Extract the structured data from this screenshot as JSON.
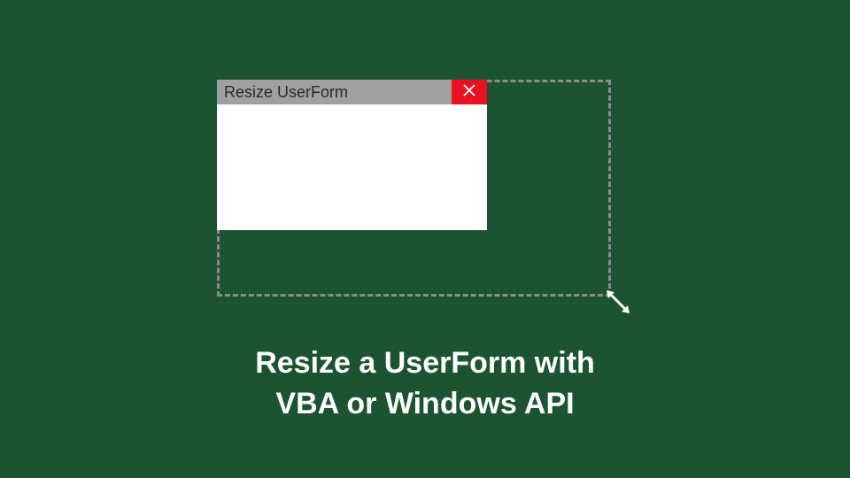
{
  "userform": {
    "title": "Resize UserForm"
  },
  "caption": {
    "line1": "Resize a UserForm with",
    "line2": "VBA or Windows API"
  }
}
